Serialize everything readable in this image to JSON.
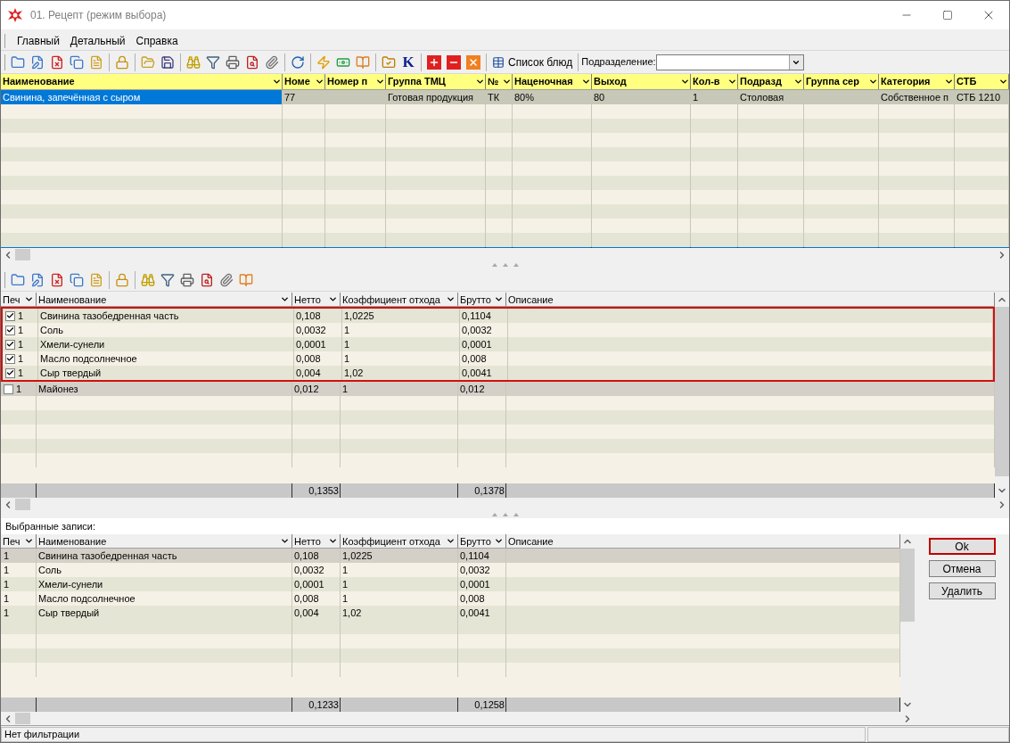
{
  "window": {
    "title": "01. Рецепт (режим выбора)"
  },
  "menu": [
    "Главный",
    "Детальный",
    "Справка"
  ],
  "toolbar": {
    "k_button": "K",
    "dish_list_button": "Список блюд",
    "division_label": "Подразделение:"
  },
  "recipes": {
    "columns": [
      "Наименование",
      "Номе",
      "Номер п",
      "Группа ТМЦ",
      "№",
      "Наценочная",
      "Выход",
      "Кол-в",
      "Подразд",
      "Группа сер",
      "Категория",
      "СТБ"
    ],
    "rows": [
      {
        "selected": true,
        "cells": [
          "Свинина, запечённая с сыром",
          "77",
          "",
          "Готовая продукция",
          "ТК",
          "80%",
          "80",
          "1",
          "Столовая",
          "",
          "Собственное п",
          "СТБ 1210"
        ]
      }
    ]
  },
  "ingredients": {
    "columns": [
      "Печ",
      "Наименование",
      "Нетто",
      "Коэффициент отхода",
      "Брутто",
      "Описание"
    ],
    "rows": [
      {
        "checked": true,
        "selected": false,
        "count": "1",
        "name": "Свинина тазобедренная часть",
        "net": "0,108",
        "waste": "1,0225",
        "gross": "0,1104"
      },
      {
        "checked": true,
        "selected": false,
        "count": "1",
        "name": "Соль",
        "net": "0,0032",
        "waste": "1",
        "gross": "0,0032"
      },
      {
        "checked": true,
        "selected": false,
        "count": "1",
        "name": "Хмели-сунели",
        "net": "0,0001",
        "waste": "1",
        "gross": "0,0001"
      },
      {
        "checked": true,
        "selected": false,
        "count": "1",
        "name": "Масло подсолнечное",
        "net": "0,008",
        "waste": "1",
        "gross": "0,008"
      },
      {
        "checked": true,
        "selected": false,
        "count": "1",
        "name": "Сыр твердый",
        "net": "0,004",
        "waste": "1,02",
        "gross": "0,0041"
      },
      {
        "checked": false,
        "selected": true,
        "count": "1",
        "name": "Майонез",
        "net": "0,012",
        "waste": "1",
        "gross": "0,012"
      }
    ],
    "totals": {
      "net": "0,1353",
      "gross": "0,1378"
    }
  },
  "selected_records": {
    "label": "Выбранные записи:",
    "columns": [
      "Печ",
      "Наименование",
      "Нетто",
      "Коэффициент отхода",
      "Брутто",
      "Описание"
    ],
    "rows": [
      {
        "selected": true,
        "count": "1",
        "name": "Свинина тазобедренная часть",
        "net": "0,108",
        "waste": "1,0225",
        "gross": "0,1104"
      },
      {
        "selected": false,
        "count": "1",
        "name": "Соль",
        "net": "0,0032",
        "waste": "1",
        "gross": "0,0032"
      },
      {
        "selected": false,
        "count": "1",
        "name": "Хмели-сунели",
        "net": "0,0001",
        "waste": "1",
        "gross": "0,0001"
      },
      {
        "selected": false,
        "count": "1",
        "name": "Масло подсолнечное",
        "net": "0,008",
        "waste": "1",
        "gross": "0,008"
      },
      {
        "selected": false,
        "count": "1",
        "name": "Сыр твердый",
        "net": "0,004",
        "waste": "1,02",
        "gross": "0,0041"
      }
    ],
    "totals": {
      "net": "0,1233",
      "gross": "0,1258"
    }
  },
  "buttons": [
    {
      "label": "Ok",
      "focused": true
    },
    {
      "label": "Отмена",
      "focused": false
    },
    {
      "label": "Удалить",
      "focused": false
    }
  ],
  "status_bar": "Нет фильтрации"
}
